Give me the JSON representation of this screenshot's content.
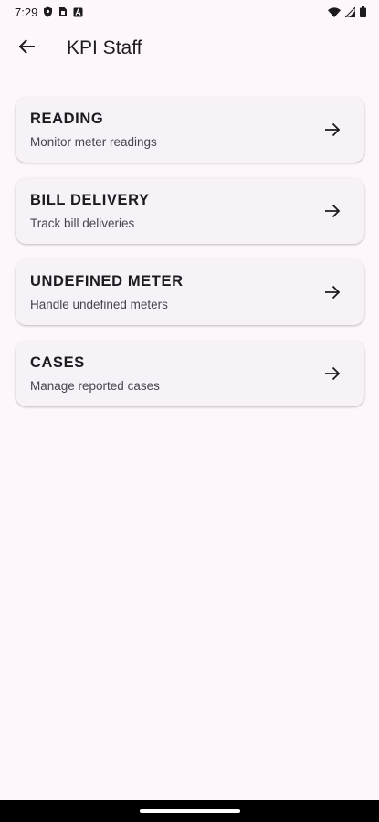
{
  "status_bar": {
    "time": "7:29",
    "icons": [
      "shield-icon",
      "sim-card-icon",
      "notification-a-icon",
      "wifi-icon",
      "cellular-signal-icon",
      "battery-icon"
    ]
  },
  "app_bar": {
    "title": "KPI Staff",
    "back_icon": "arrow-back-icon"
  },
  "menu": {
    "items": [
      {
        "title": "READING",
        "subtitle": "Monitor meter readings",
        "icon": "arrow-forward-icon"
      },
      {
        "title": "BILL DELIVERY",
        "subtitle": "Track bill deliveries",
        "icon": "arrow-forward-icon"
      },
      {
        "title": "UNDEFINED METER",
        "subtitle": "Handle undefined meters",
        "icon": "arrow-forward-icon"
      },
      {
        "title": "CASES",
        "subtitle": "Manage reported cases",
        "icon": "arrow-forward-icon"
      }
    ]
  },
  "colors": {
    "background": "#fdf7fc",
    "card": "#f7f1f8",
    "text": "#1d1b20",
    "subtext": "#49454f",
    "nav_bar": "#000000"
  }
}
